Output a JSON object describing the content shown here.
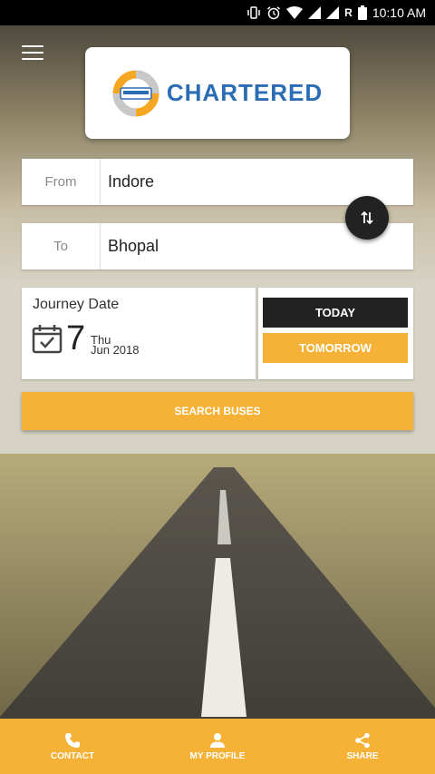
{
  "status_bar": {
    "time": "10:10 AM",
    "network_label": "R"
  },
  "brand": {
    "name": "CHARTERED"
  },
  "route": {
    "from_label": "From",
    "from_value": "Indore",
    "to_label": "To",
    "to_value": "Bhopal"
  },
  "journey": {
    "title": "Journey Date",
    "day": "7",
    "weekday": "Thu",
    "month_year": "Jun 2018"
  },
  "quick_dates": {
    "today_label": "TODAY",
    "tomorrow_label": "TOMORROW"
  },
  "search": {
    "button_label": "SEARCH BUSES"
  },
  "bottom_nav": {
    "contact_label": "CONTACT",
    "profile_label": "MY PROFILE",
    "share_label": "SHARE"
  },
  "colors": {
    "accent": "#f5b237",
    "dark": "#222222",
    "brand_blue": "#2a6db4"
  }
}
